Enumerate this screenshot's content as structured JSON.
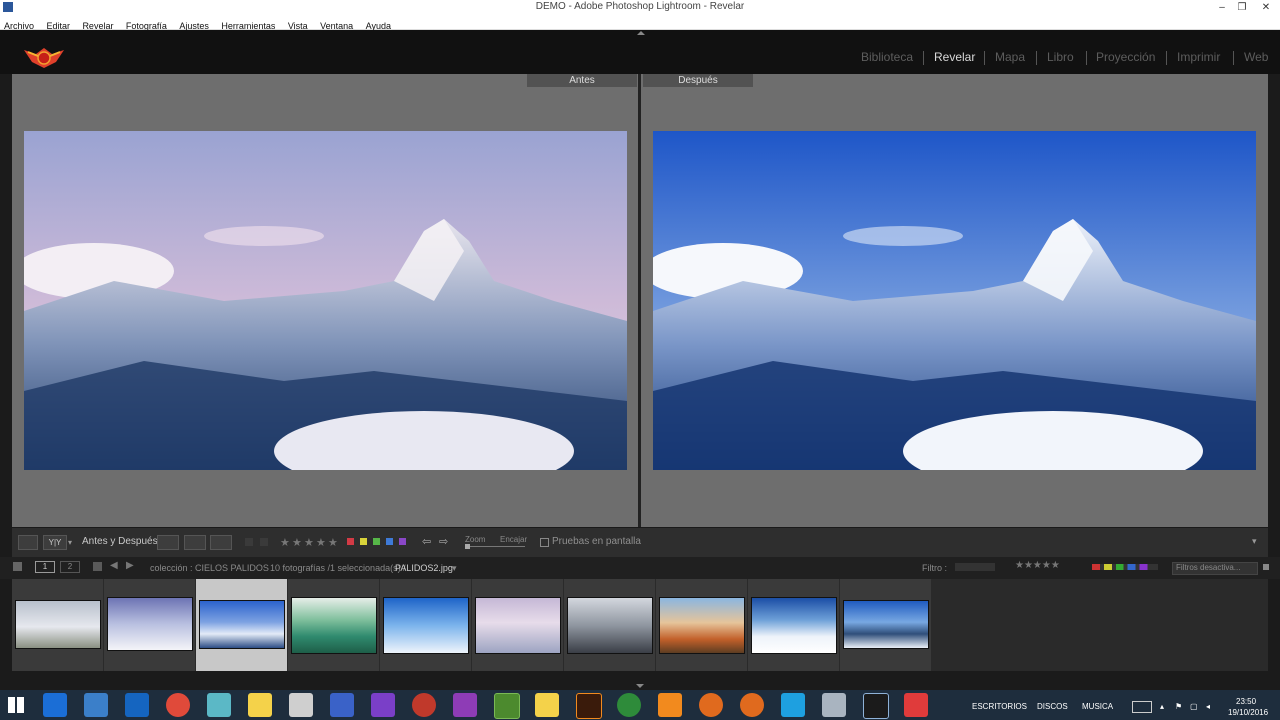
{
  "window": {
    "title": "DEMO - Adobe Photoshop Lightroom - Revelar",
    "min": "–",
    "max": "❐",
    "close": "✕"
  },
  "menu": [
    "Archivo",
    "Editar",
    "Revelar",
    "Fotografía",
    "Ajustes",
    "Herramientas",
    "Vista",
    "Ventana",
    "Ayuda"
  ],
  "modules": [
    {
      "label": "Biblioteca",
      "active": false
    },
    {
      "label": "Revelar",
      "active": true
    },
    {
      "label": "Mapa",
      "active": false
    },
    {
      "label": "Libro",
      "active": false
    },
    {
      "label": "Proyección",
      "active": false
    },
    {
      "label": "Imprimir",
      "active": false
    },
    {
      "label": "Web",
      "active": false
    }
  ],
  "view": {
    "before_label": "Antes",
    "after_label": "Después"
  },
  "toolbar": {
    "view_mode_icon": "Y|Y",
    "before_after_label": "Antes y Después:",
    "stars": [
      "★",
      "★",
      "★",
      "★",
      "★"
    ],
    "zoom_label": "Zoom",
    "fit_label": "Encajar",
    "softproof_label": "Pruebas en pantalla"
  },
  "filmstrip_header": {
    "page1": "1",
    "page2": "2",
    "collection": "colección : CIELOS PALIDOS",
    "count": "10 fotografías /1 seleccionada(s) /",
    "filename": "PALIDOS2.jpg",
    "filter_label": "Filtro :",
    "filter_value": "Filtros desactiva..."
  },
  "filmstrip": {
    "count": 10,
    "selected_index": 2
  },
  "taskbar": {
    "tray_items": [
      "ESCRITORIOS",
      "DISCOS",
      "MUSICA"
    ],
    "time": "23:50",
    "date": "19/10/2016"
  },
  "colors": {
    "accent_active": "#d9d9d9",
    "module_inactive": "#5d5d5d",
    "label_red": "#d33a45",
    "label_yellow": "#d8d33a",
    "label_green": "#56b648",
    "label_blue": "#3e7ad7",
    "label_purple": "#8a47c7"
  }
}
